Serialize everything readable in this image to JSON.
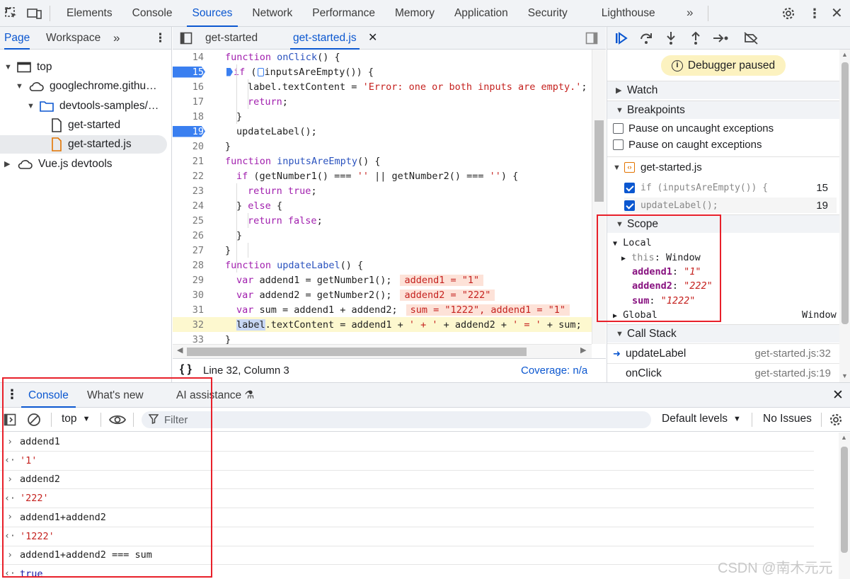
{
  "main_tabs": [
    "Elements",
    "Console",
    "Sources",
    "Network",
    "Performance",
    "Memory",
    "Application",
    "Security",
    "Lighthouse"
  ],
  "navigator": {
    "tabs": [
      "Page",
      "Workspace"
    ],
    "tree": [
      {
        "label": "top",
        "icon": "frame-icon",
        "depth": 0,
        "expanded": true
      },
      {
        "label": "googlechrome.githu…",
        "icon": "cloud-icon",
        "depth": 1,
        "expanded": true
      },
      {
        "label": "devtools-samples/…",
        "icon": "folder-icon",
        "depth": 2,
        "expanded": true
      },
      {
        "label": "get-started",
        "icon": "file-icon",
        "depth": 3
      },
      {
        "label": "get-started.js",
        "icon": "js-file-icon",
        "depth": 3,
        "selected": true
      },
      {
        "label": "Vue.js devtools",
        "icon": "cloud-icon",
        "depth": 0,
        "expanded": false
      }
    ]
  },
  "editor": {
    "tabs": [
      "get-started",
      "get-started.js"
    ],
    "status": {
      "position": "Line 32, Column 3",
      "coverage": "Coverage: n/a"
    },
    "lines": [
      {
        "n": "14",
        "html": "<span class='kw'>function</span> <span class='fn'>onClick</span>() {",
        "indent": 0
      },
      {
        "n": "15",
        "bp": true,
        "html": "<span class='kw'>if</span> (inputsAreEmpty()) {",
        "indent": 1
      },
      {
        "n": "16",
        "html": "label.textContent = <span class='str'>'Error: one or both inputs are empty.'</span>;",
        "indent": 2
      },
      {
        "n": "17",
        "html": "<span class='kw'>return</span>;",
        "indent": 2
      },
      {
        "n": "18",
        "html": "}",
        "indent": 1
      },
      {
        "n": "19",
        "bp": true,
        "html": "updateLabel();",
        "indent": 1
      },
      {
        "n": "20",
        "html": "}",
        "indent": 0
      },
      {
        "n": "21",
        "html": "<span class='kw'>function</span> <span class='fn'>inputsAreEmpty</span>() {",
        "indent": 0
      },
      {
        "n": "22",
        "html": "<span class='kw'>if</span> (getNumber1() === <span class='str'>''</span> || getNumber2() === <span class='str'>''</span>) {",
        "indent": 1
      },
      {
        "n": "23",
        "html": "<span class='kw'>return</span> <span class='kw'>true</span>;",
        "indent": 2
      },
      {
        "n": "24",
        "html": "} <span class='kw'>else</span> {",
        "indent": 1
      },
      {
        "n": "25",
        "html": "<span class='kw'>return</span> <span class='kw'>false</span>;",
        "indent": 2
      },
      {
        "n": "26",
        "html": "}",
        "indent": 1
      },
      {
        "n": "27",
        "html": "}",
        "indent": 0
      },
      {
        "n": "28",
        "html": "<span class='kw'>function</span> <span class='fn'>updateLabel</span>() {",
        "indent": 0
      },
      {
        "n": "29",
        "html": "<span class='kw'>var</span> addend1 = getNumber1();<span class='inl'>addend1 = \"1\"</span>",
        "indent": 1
      },
      {
        "n": "30",
        "html": "<span class='kw'>var</span> addend2 = getNumber2();<span class='inl'>addend2 = \"222\"</span>",
        "indent": 1
      },
      {
        "n": "31",
        "html": "<span class='kw'>var</span> sum = addend1 + addend2;<span class='inl'>sum = \"1222\", addend1 = \"1\"</span>",
        "indent": 1
      },
      {
        "n": "32",
        "hl": true,
        "html": "<span style='background:#c8d7f5'>label</span>.textContent = addend1 + <span class='str'>' + '</span> + addend2 + <span class='str'>' = '</span> + sum;",
        "indent": 1
      },
      {
        "n": "33",
        "html": "}",
        "indent": 0
      }
    ]
  },
  "debugger": {
    "paused_label": "Debugger paused",
    "sections": {
      "watch": "Watch",
      "breakpoints": "Breakpoints",
      "scope": "Scope",
      "call_stack": "Call Stack"
    },
    "pause_uncaught": "Pause on uncaught exceptions",
    "pause_caught": "Pause on caught exceptions",
    "bp_file": "get-started.js",
    "bp_items": [
      {
        "code": "if (inputsAreEmpty()) {",
        "line": "15"
      },
      {
        "code": "updateLabel();",
        "line": "19"
      }
    ],
    "scope": {
      "local_label": "Local",
      "this_name": "this",
      "this_value": "Window",
      "vars": [
        {
          "name": "addend1",
          "value": "\"1\""
        },
        {
          "name": "addend2",
          "value": "\"222\""
        },
        {
          "name": "sum",
          "value": "\"1222\""
        }
      ],
      "global_label": "Global",
      "global_value": "Window"
    },
    "call_stack": [
      {
        "fn": "updateLabel",
        "loc": "get-started.js:32",
        "current": true
      },
      {
        "fn": "onClick",
        "loc": "get-started.js:19"
      }
    ]
  },
  "drawer": {
    "tabs": [
      "Console",
      "What's new",
      "AI assistance"
    ],
    "context": "top",
    "filter_placeholder": "Filter",
    "levels": "Default levels",
    "issues": "No Issues",
    "entries": [
      {
        "kind": "input",
        "text": "addend1"
      },
      {
        "kind": "output",
        "text": "'1'"
      },
      {
        "kind": "input",
        "text": "addend2"
      },
      {
        "kind": "output",
        "text": "'222'"
      },
      {
        "kind": "input",
        "text": "addend1+addend2"
      },
      {
        "kind": "output",
        "text": "'1222'"
      },
      {
        "kind": "input",
        "text": "addend1+addend2 === sum"
      },
      {
        "kind": "output",
        "text": "true"
      }
    ]
  },
  "watermark": "CSDN @南木元元",
  "colors": {
    "accent": "#0b57d0",
    "breakpoint": "#3a7ff0",
    "highlight_box": "#e8202a",
    "string": "#c5221f",
    "keyword": "#a11fae"
  }
}
